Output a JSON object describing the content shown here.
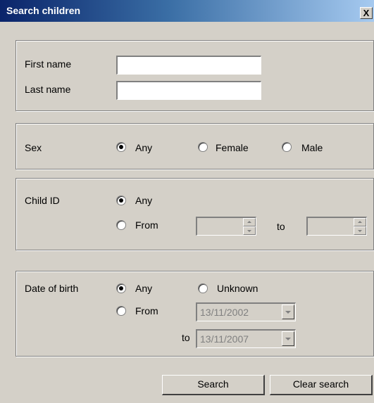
{
  "window": {
    "title": "Search children",
    "close_glyph": "X"
  },
  "name_section": {
    "first_name_label": "First name",
    "first_name_value": "",
    "last_name_label": "Last name",
    "last_name_value": ""
  },
  "sex_section": {
    "label": "Sex",
    "options": [
      "Any",
      "Female",
      "Male"
    ],
    "selected": "Any"
  },
  "child_id_section": {
    "label": "Child ID",
    "any_label": "Any",
    "from_label": "From",
    "to_label": "to",
    "selected": "Any",
    "from_value": "",
    "to_value": ""
  },
  "dob_section": {
    "label": "Date of birth",
    "any_label": "Any",
    "unknown_label": "Unknown",
    "from_label": "From",
    "to_label": "to",
    "from_date": "13/11/2002",
    "to_date": "13/11/2007",
    "selected": "Any"
  },
  "buttons": {
    "search": "Search",
    "clear": "Clear search"
  },
  "icons": {
    "close": "close-icon",
    "spin_up": "spin-up-icon",
    "spin_down": "spin-down-icon",
    "dropdown": "chevron-down-icon"
  }
}
